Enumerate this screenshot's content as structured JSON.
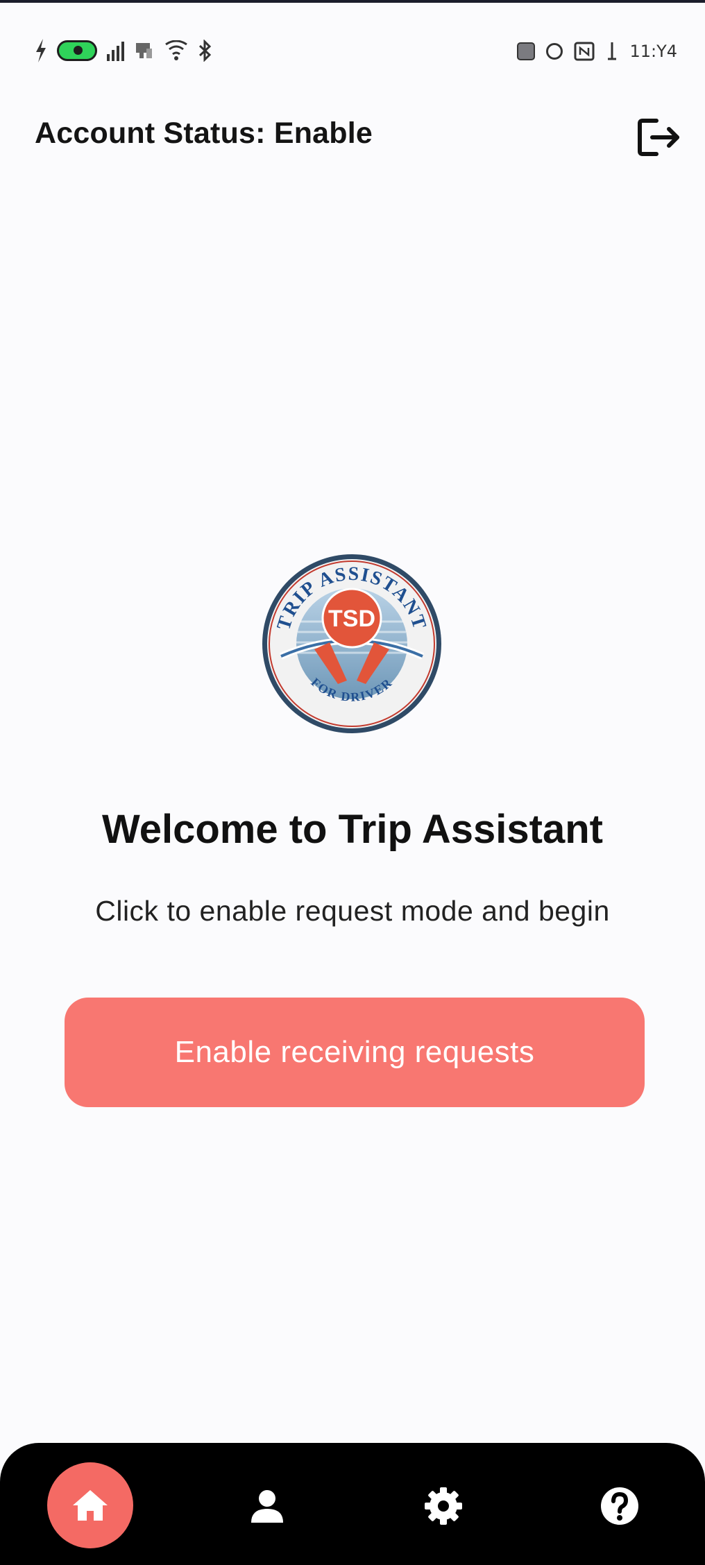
{
  "status_bar": {
    "left_icons": [
      "flash-icon",
      "eye-toggle-icon",
      "signal-icon",
      "notification-icon",
      "wifi-icon",
      "bluetooth-icon"
    ],
    "right_icons": [
      "screenshot-icon",
      "alarm-icon",
      "nfc-icon",
      "battery-icon"
    ],
    "time": "11:Y4"
  },
  "header": {
    "title": "Account Status: Enable",
    "logout_icon": "logout-icon"
  },
  "logo": {
    "ring_text_top": "TRIP ASSISTANT",
    "badge_text": "TSD",
    "ring_text_bottom": "FOR DRIVER"
  },
  "main": {
    "welcome": "Welcome to Trip Assistant",
    "subtitle": "Click to enable request mode and begin",
    "enable_button_label": "Enable receiving requests"
  },
  "bottom_nav": {
    "items": [
      {
        "icon": "home-icon",
        "active": true
      },
      {
        "icon": "profile-icon",
        "active": false
      },
      {
        "icon": "settings-icon",
        "active": false
      },
      {
        "icon": "help-icon",
        "active": false
      }
    ]
  },
  "colors": {
    "accent": "#f87771",
    "nav_bg": "#000000",
    "nav_active": "#f46a64"
  }
}
